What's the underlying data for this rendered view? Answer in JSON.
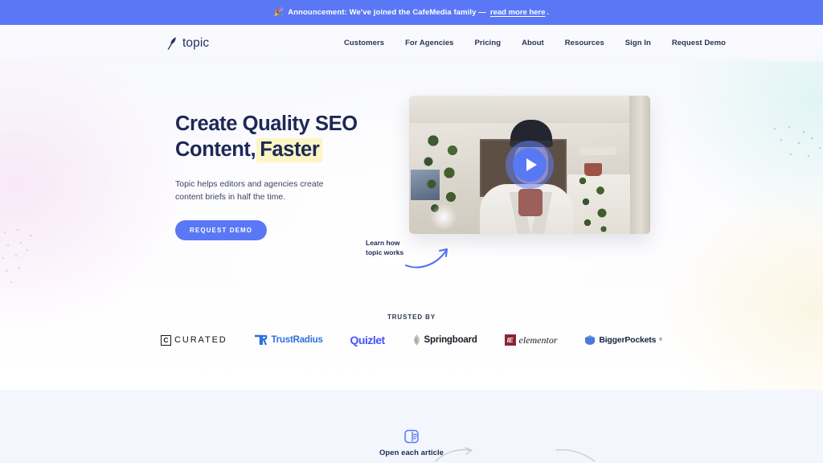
{
  "announcement": {
    "emoji": "🎉",
    "emoji_name": "party-popper-emoji",
    "text": "Announcement: We've joined the CafeMedia family —",
    "link_text": "read more here",
    "period": ".",
    "bg_color": "#5a78f5"
  },
  "nav": {
    "logo_text": "topic",
    "logo_icon": "feather-quill-icon",
    "links": [
      {
        "label": "Customers"
      },
      {
        "label": "For Agencies"
      },
      {
        "label": "Pricing"
      },
      {
        "label": "About"
      },
      {
        "label": "Resources"
      },
      {
        "label": "Sign In"
      },
      {
        "label": "Request Demo"
      }
    ]
  },
  "hero": {
    "heading_line1": "Create Quality SEO",
    "heading_line2_pre": "Content,",
    "heading_line2_highlight": "Faster",
    "highlight_color": "#fbf6c4",
    "subtext": "Topic helps editors and agencies create content briefs in half the time.",
    "cta_label": "REQUEST DEMO",
    "cta_color": "#5a78f5",
    "annotation_line1": "Learn how",
    "annotation_line2": "topic works",
    "video": {
      "play_button": "play-icon",
      "alt": "Video thumbnail: person in white shirt and dark beanie in a room with plants"
    }
  },
  "trusted": {
    "label": "TRUSTED BY",
    "logos": [
      {
        "name": "Curated",
        "mark": "C",
        "text": "CURATED"
      },
      {
        "name": "TrustRadius",
        "mark": "TR",
        "text": "TrustRadius"
      },
      {
        "name": "Quizlet",
        "text": "Quizlet"
      },
      {
        "name": "Springboard",
        "text": "Springboard"
      },
      {
        "name": "Elementor",
        "mark": "IE",
        "text": "elementor"
      },
      {
        "name": "BiggerPockets",
        "text": "BiggerPockets",
        "tm": "®"
      }
    ]
  },
  "band": {
    "item_label": "Open each article",
    "item_icon": "article-window-icon",
    "bg_color": "#f3f7fd"
  }
}
